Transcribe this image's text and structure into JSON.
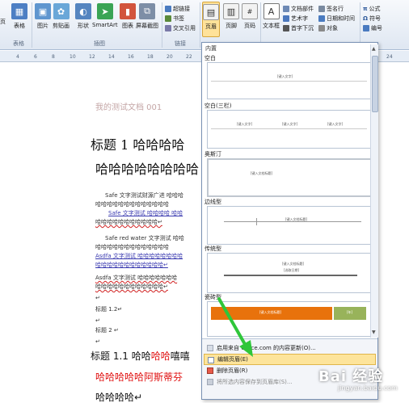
{
  "ribbon": {
    "table": "表格",
    "picture": "图片",
    "clipart": "剪贴画",
    "shapes": "形状",
    "smartart": "SmartArt",
    "chart": "图表",
    "screenshot": "屏幕截图",
    "hyperlink": "超链接",
    "bookmark": "书签",
    "crossref": "交叉引用",
    "header": "页眉",
    "footer": "页脚",
    "pagenum": "页码",
    "textbox": "文本框",
    "parts": "文档部件",
    "wordart": "艺术字",
    "dropcap": "首字下沉",
    "sigline": "签名行",
    "datetime": "日期和时间",
    "object": "对象",
    "equation": "公式",
    "symbol": "符号",
    "number": "编号",
    "group_tables": "表格",
    "group_illustrations": "插图",
    "group_links": "链接",
    "left_cut": "页"
  },
  "ruler": {
    "marks": [
      "4",
      "6",
      "8",
      "10",
      "12",
      "14",
      "16",
      "18",
      "20",
      "22",
      "24"
    ]
  },
  "document": {
    "header_text": "我的测试文档 001",
    "title1_a": "标题 1 哈哈哈哈",
    "title1_b": "哈哈哈哈哈哈哈哈",
    "p1_line1": "Safe 文字测试财源广进 哈哈哈",
    "p1_line2": "哈哈哈哈哈哈哈哈哈哈哈哈哈",
    "p1_line3": "Safe 文字测试 哈哈哈哈 哈哈",
    "p1_line4": "哈哈哈哈哈哈哈哈哈哈哈↵",
    "p2_line1": "Safe red water 文字测试 哈哈",
    "p2_line2": "哈哈哈哈哈哈哈哈哈哈哈哈哈",
    "p2_line3": "Asdfa 文字测试 哈哈哈哈哈哈哈哈",
    "p2_line4": "哈哈哈哈哈哈哈哈哈哈哈哈↵",
    "p3_line1": "Asdfa 文字测试 哈哈哈哈哈哈哈",
    "p3_line2": "哈哈哈哈哈哈哈哈哈哈哈哈↵",
    "blank1": "↵",
    "title12": "标题 1.2↵",
    "blank2": "↵",
    "title2": "标题 2 ↵",
    "blank3": "↵",
    "title11_a": "标题 1.1 哈哈",
    "title11_red1": "哈哈",
    "title11_b": "嘻嘻",
    "title11_c": "哈哈哈哈哈阿斯蒂芬",
    "title11_d": "哈哈哈哈↵"
  },
  "gallery": {
    "builtin": "内置",
    "blank": "空白",
    "blank3": "空白(三栏)",
    "austere": "奥斯汀",
    "edge": "边线型",
    "traditional": "传统型",
    "annual": "瓷砖型",
    "t_blank_text": "[键入文字]",
    "t_blank3_a": "[键入文字]",
    "t_blank3_b": "[键入文字]",
    "t_blank3_c": "[键入文字]",
    "t_austere_text": "[键入文档标题]",
    "t_edge_text": "[键入文档标题]",
    "t_trad_title": "[键入文档标题]",
    "t_trad_date": "[选取日期]",
    "t_tile_title": "[键入文档标题]",
    "t_tile_year": "[年]",
    "more_online": "启用来自 Office.com 的内容更新(O)...",
    "edit_header": "编辑页眉(E)",
    "remove_header": "删除页眉(R)",
    "save_selection": "将所选内容保存到页眉库(S)..."
  },
  "watermark": {
    "brand": "Bai 经验",
    "url": "jingyan.baidu.com"
  },
  "colors": {
    "accent": "#2b579a",
    "highlight": "#fde49b",
    "arrow": "#2fc63a",
    "tile_orange": "#e8720c"
  }
}
